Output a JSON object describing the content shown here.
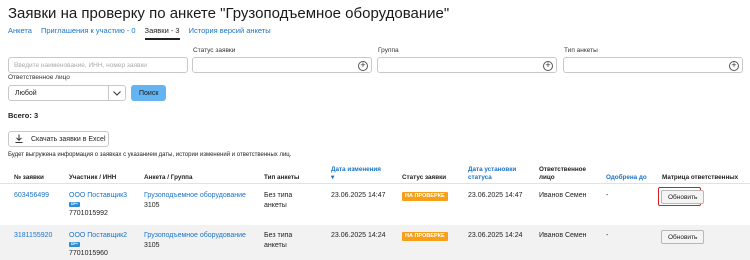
{
  "page": {
    "title": "Заявки на проверку по анкете \"Грузоподъемное оборудование\""
  },
  "tabs": [
    {
      "label": "Анкета",
      "active": false
    },
    {
      "label": "Приглашения к участию - 0",
      "active": false
    },
    {
      "label": "Заявки - 3",
      "active": true
    },
    {
      "label": "История версий анкеты",
      "active": false
    }
  ],
  "filters": {
    "search_placeholder": "Введите наименование, ИНН, номер заявки",
    "status_label": "Статус заявки",
    "group_label": "Группа",
    "type_label": "Тип анкеты",
    "responsible_label": "Ответственное лицо",
    "responsible_value": "Любой",
    "search_button": "Поиск"
  },
  "summary": {
    "total": "Всего: 3"
  },
  "export": {
    "button_label": "Скачать заявки в Excel",
    "note": "Будет выгружена информация о заявках с указанием даты, истории изменений и ответственных лиц."
  },
  "table": {
    "headers": {
      "number": "№ заявки",
      "participant": "Участник / ИНН",
      "form_group": "Анкета / Группа",
      "form_type": "Тип анкеты",
      "changed": "Дата изменения ▾",
      "status": "Статус заявки",
      "status_date": "Дата установки статуса",
      "responsible": "Ответственное лицо",
      "approved_until": "Одобрена до",
      "matrix": "Матрица ответственных"
    },
    "rows": [
      {
        "number": "603456499",
        "participant": "ООО Поставщик3",
        "badge": "DP+",
        "inn": "7701015992",
        "form": "Грузоподъемное оборудование",
        "group": "3105",
        "type": "Без типа анкеты",
        "changed": "23.06.2025 14:47",
        "status": "НА ПРОВЕРКЕ",
        "status_date": "23.06.2025 14:47",
        "responsible": "Иванов Семен",
        "approved_until": "-",
        "action": "Обновить",
        "highlighted": true
      },
      {
        "number": "3181155920",
        "participant": "ООО Поставщик2",
        "badge": "DP+",
        "inn": "7701015960",
        "form": "Грузоподъемное оборудование",
        "group": "3105",
        "type": "Без типа анкеты",
        "changed": "23.06.2025 14:24",
        "status": "НА ПРОВЕРКЕ",
        "status_date": "23.06.2025 14:24",
        "responsible": "Иванов Семен",
        "approved_until": "-",
        "action": "Обновить",
        "highlighted": false
      }
    ]
  },
  "colors": {
    "link": "#1a73c8",
    "status_badge": "#f6a01a",
    "search_button": "#63b4f0",
    "highlight": "#d32020"
  },
  "icons": {
    "plus": "plus-circle-icon",
    "chevron": "chevron-down-icon",
    "download": "download-icon"
  }
}
